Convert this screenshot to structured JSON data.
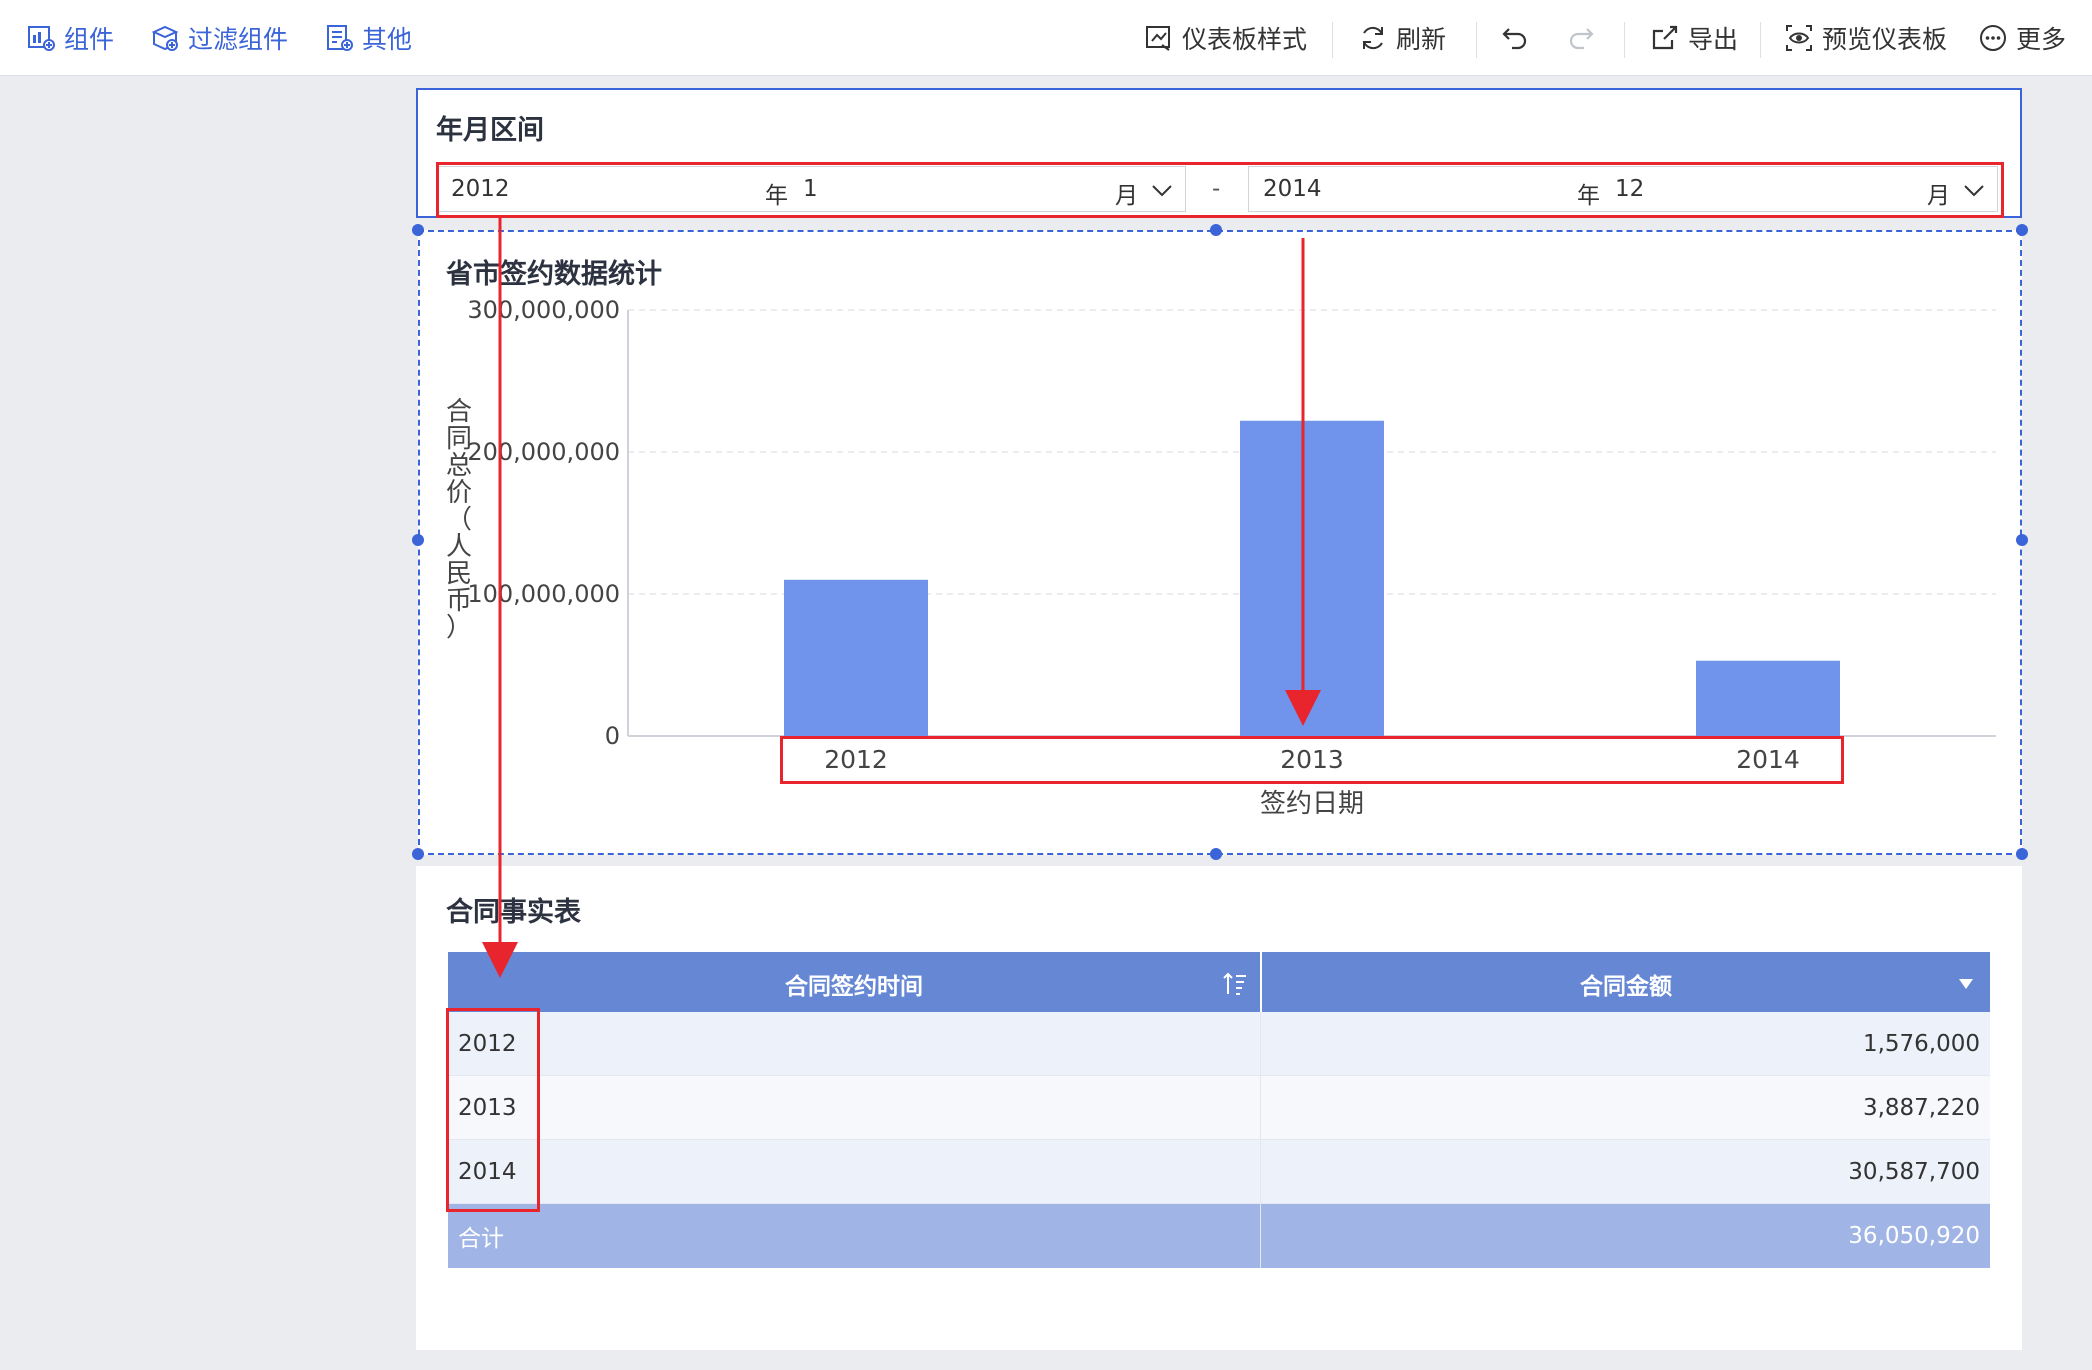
{
  "toolbar": {
    "left": [
      {
        "label": "组件",
        "icon": "component-icon"
      },
      {
        "label": "过滤组件",
        "icon": "filter-component-icon"
      },
      {
        "label": "其他",
        "icon": "other-icon"
      }
    ],
    "right": [
      {
        "label": "仪表板样式",
        "icon": "dashboard-style-icon"
      },
      {
        "label": "刷新",
        "icon": "refresh-icon"
      },
      {
        "label": "导出",
        "icon": "export-icon"
      },
      {
        "label": "预览仪表板",
        "icon": "preview-icon"
      },
      {
        "label": "更多",
        "icon": "more-icon"
      }
    ]
  },
  "filter": {
    "title": "年月区间",
    "start": {
      "year": "2012",
      "year_unit": "年",
      "month": "1",
      "month_unit": "月"
    },
    "separator": "-",
    "end": {
      "year": "2014",
      "year_unit": "年",
      "month": "12",
      "month_unit": "月"
    }
  },
  "chart": {
    "title": "省市签约数据统计"
  },
  "chart_data": {
    "type": "bar",
    "categories": [
      "2012",
      "2013",
      "2014"
    ],
    "values": [
      110000000,
      222000000,
      53000000
    ],
    "title": "省市签约数据统计",
    "xlabel": "签约日期",
    "ylabel": "合同总价（人民币）",
    "ylim": [
      0,
      300000000
    ],
    "yticks": [
      "0",
      "100,000,000",
      "200,000,000",
      "300,000,000"
    ],
    "bar_color": "#7093ec",
    "grid": true
  },
  "table": {
    "title": "合同事实表",
    "headers": [
      "合同签约时间",
      "合同金额"
    ],
    "rows": [
      [
        "2012",
        "1,576,000"
      ],
      [
        "2013",
        "3,887,220"
      ],
      [
        "2014",
        "30,587,700"
      ]
    ],
    "total": [
      "合计",
      "36,050,920"
    ]
  },
  "colors": {
    "accent": "#3a64d8",
    "annotation": "#e8242c",
    "header": "#6688d4",
    "total": "#a0b5e5"
  }
}
